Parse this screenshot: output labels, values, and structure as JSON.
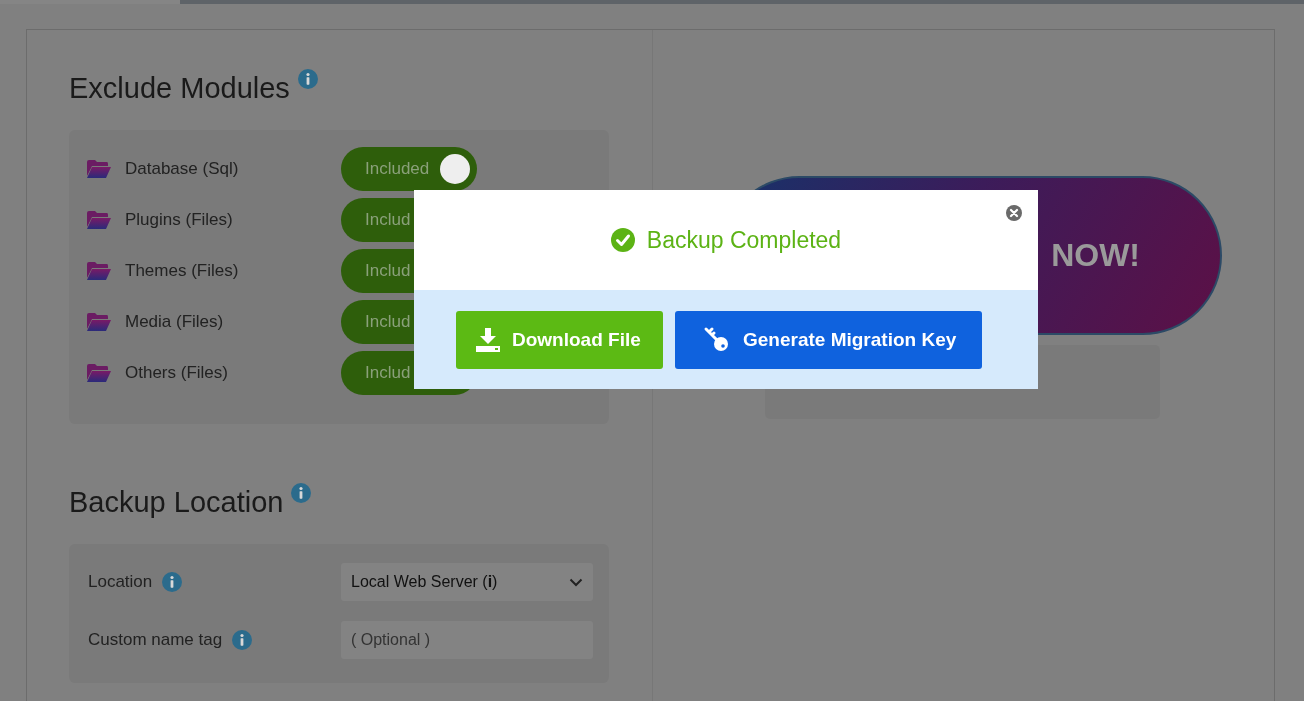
{
  "exclude_modules": {
    "title": "Exclude Modules",
    "modules": [
      {
        "name": "Database (Sql)",
        "toggle_label": "Included",
        "on": true
      },
      {
        "name": "Plugins (Files)",
        "toggle_label": "Includ",
        "on": true
      },
      {
        "name": "Themes (Files)",
        "toggle_label": "Includ",
        "on": true
      },
      {
        "name": "Media (Files)",
        "toggle_label": "Includ",
        "on": true
      },
      {
        "name": "Others (Files)",
        "toggle_label": "Includ",
        "on": true
      }
    ]
  },
  "backup_location": {
    "title": "Backup Location",
    "fields": [
      {
        "kind": "select",
        "label": "Location",
        "value": "Local Web Server (**i**)"
      },
      {
        "kind": "text",
        "label": "Custom name tag",
        "placeholder": "( Optional )"
      }
    ]
  },
  "backup_now_button": {
    "label": "NOW!"
  },
  "modal": {
    "title": "Backup Completed",
    "buttons": [
      {
        "kind": "download",
        "label": "Download File"
      },
      {
        "kind": "key",
        "label": "Generate Migration Key"
      }
    ]
  }
}
